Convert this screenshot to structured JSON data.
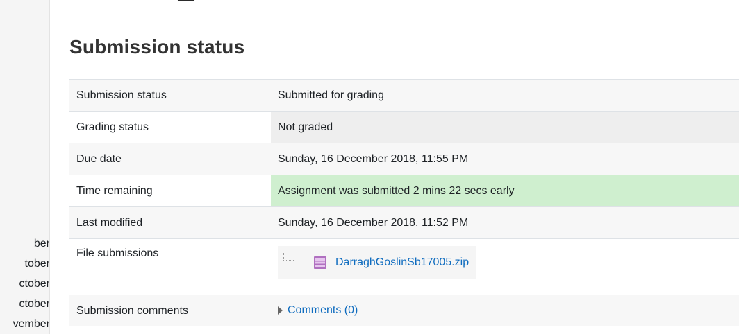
{
  "sidebar": {
    "items": [
      "ber",
      "tober",
      "ctober",
      "ctober",
      "vember"
    ]
  },
  "section": {
    "title": "Submission status"
  },
  "rows": [
    {
      "label": "Submission status",
      "value": "Submitted for grading"
    },
    {
      "label": "Grading status",
      "value": "Not graded"
    },
    {
      "label": "Due date",
      "value": "Sunday, 16 December 2018, 11:55 PM"
    },
    {
      "label": "Time remaining",
      "value": "Assignment was submitted 2 mins 22 secs early"
    },
    {
      "label": "Last modified",
      "value": "Sunday, 16 December 2018, 11:52 PM"
    },
    {
      "label": "File submissions",
      "file": "DarraghGoslinSb17005.zip"
    },
    {
      "label": "Submission comments",
      "comments_link": "Comments (0)"
    }
  ],
  "colors": {
    "link": "#0f6cbf",
    "success_bg": "#cfefcf",
    "grey_bg": "#eeeeee"
  },
  "icons": {
    "file": "zip-archive-icon",
    "expand": "caret-right-icon"
  }
}
